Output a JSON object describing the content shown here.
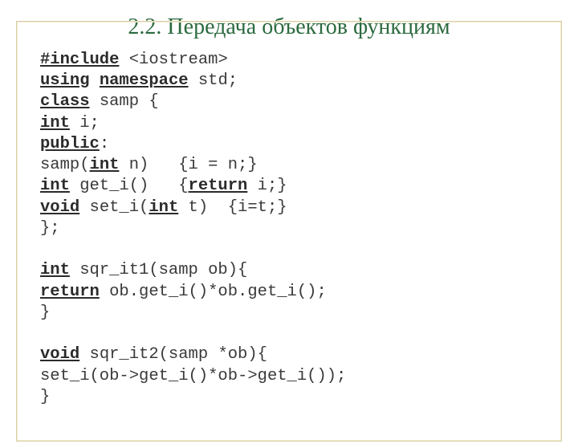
{
  "title": "2.2. Передача объектов функциям",
  "code": {
    "l1_kw": "#include",
    "l1_rest": " <iostream>",
    "l2_kw1": "using",
    "l2_kw2": "namespace",
    "l2_rest": " std;",
    "l3_kw": "class",
    "l3_rest": " samp {",
    "l4_kw": "int",
    "l4_rest": " i;",
    "l5_kw": "public",
    "l5_rest": ":",
    "l6a": "samp(",
    "l6_kw": "int",
    "l6b": " n)   {i = n;}",
    "l7_kw1": "int",
    "l7_mid": " get_i()   {",
    "l7_kw2": "return",
    "l7_end": " i;}",
    "l8_kw1": "void",
    "l8_mid": " set_i(",
    "l8_kw2": "int",
    "l8_end": " t)  {i=t;}",
    "l9": "};",
    "l10": "",
    "l11_kw": "int",
    "l11_rest": " sqr_it1(samp ob){",
    "l12_kw": "return",
    "l12_rest": " ob.get_i()*ob.get_i();",
    "l13": "}",
    "l14": "",
    "l15_kw": "void",
    "l15_rest": " sqr_it2(samp *ob){",
    "l16": "set_i(ob->get_i()*ob->get_i());",
    "l17": "}"
  }
}
